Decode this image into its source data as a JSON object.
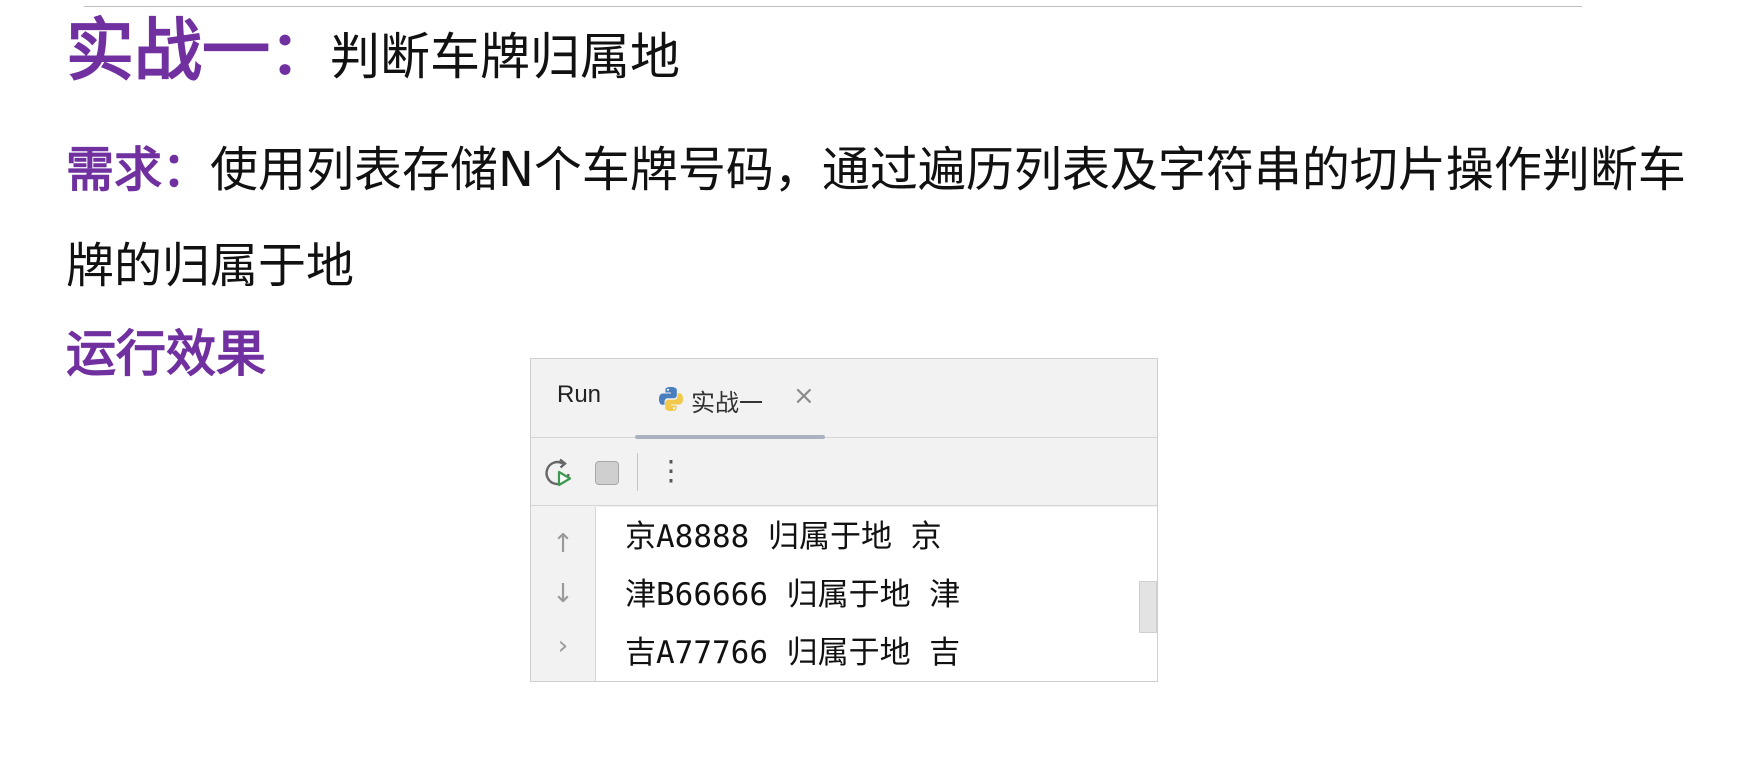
{
  "title": {
    "accent": "实战一",
    "colon": "：",
    "rest": "判断车牌归属地"
  },
  "requirement": {
    "label": "需求：",
    "text": "使用列表存储N个车牌号码，通过遍历列表及字符串的切片操作判断车牌的归属于地"
  },
  "effect_label": "运行效果",
  "run_panel": {
    "run_tab_label": "Run",
    "active_tab_label": "实战一",
    "close_glyph": "×",
    "more_glyph": "⋮",
    "gutter_icons": {
      "up": "↑",
      "down": "↓",
      "prompt": "›"
    },
    "output_lines": [
      "京A8888 归属于地 京",
      "津B66666 归属于地 津",
      "吉A77766 归属于地 吉"
    ],
    "colors": {
      "python_blue": "#4a7fbf",
      "python_yellow": "#f2c94c",
      "rerun_green": "#3d9a50"
    }
  }
}
